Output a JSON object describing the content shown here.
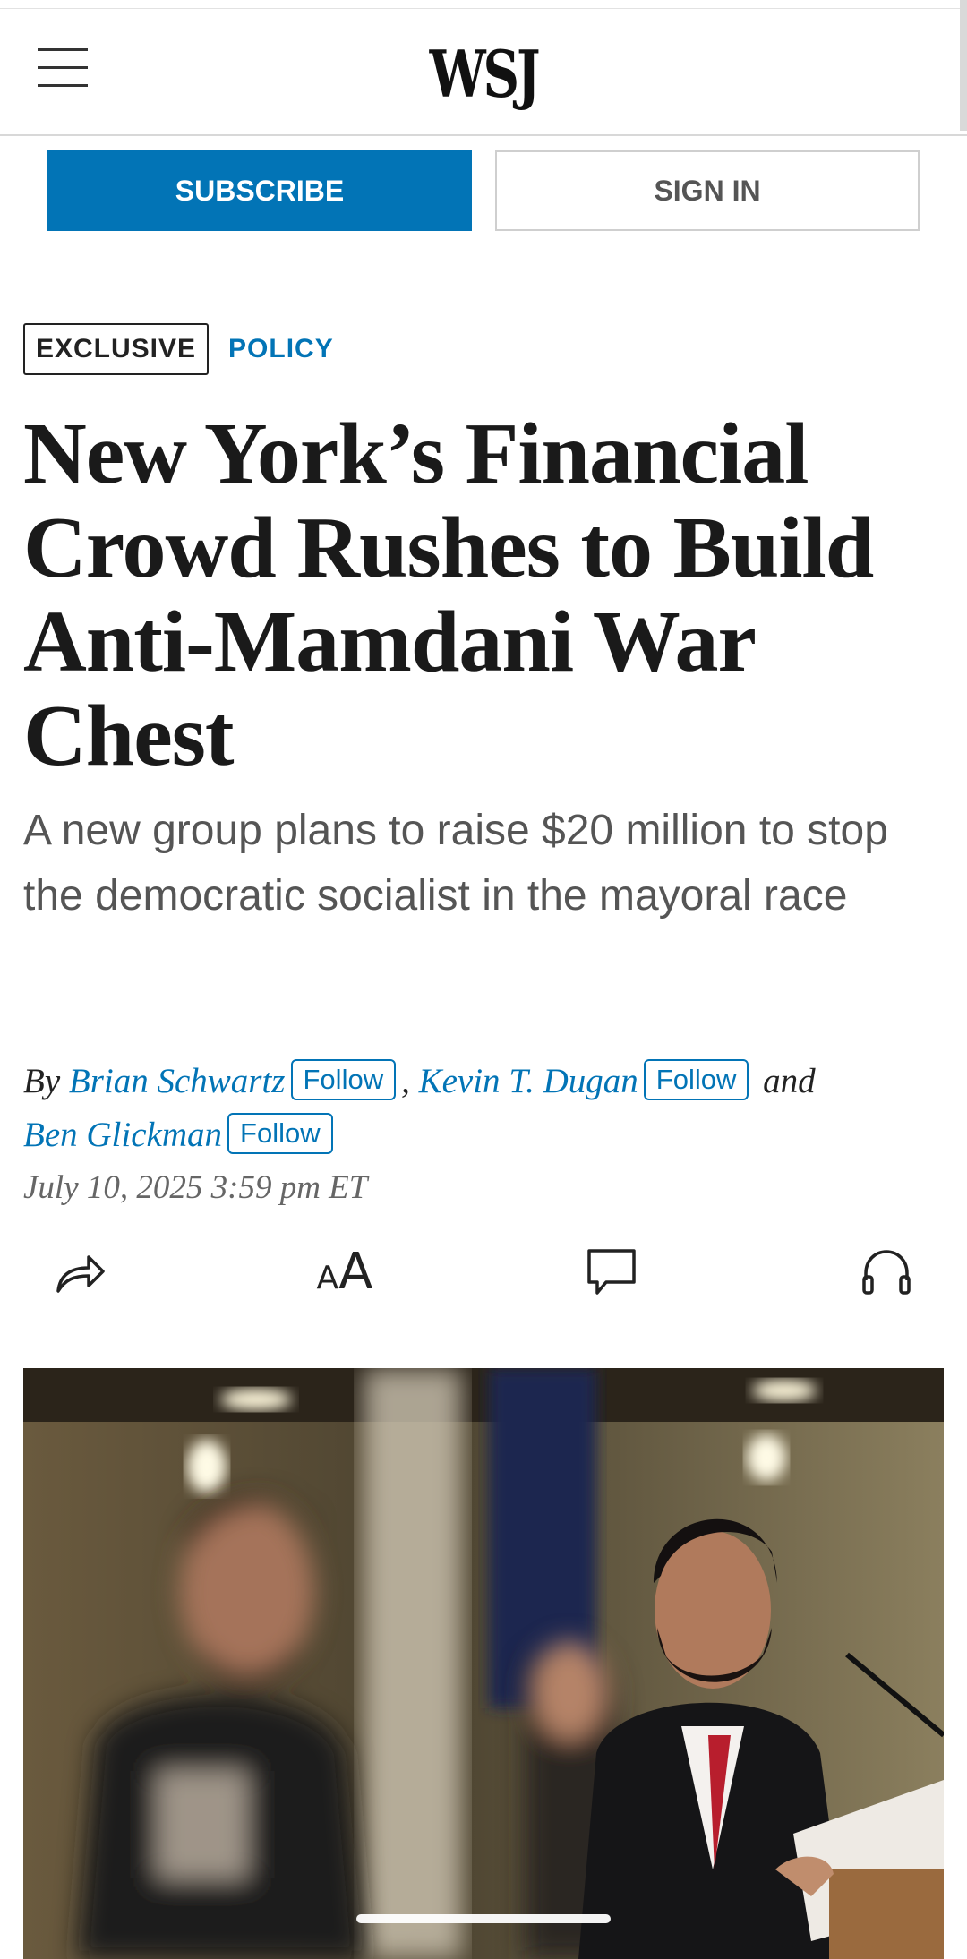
{
  "header": {
    "logo": "WSJ",
    "menu_icon": "hamburger-menu-icon"
  },
  "actions": {
    "subscribe_label": "SUBSCRIBE",
    "signin_label": "SIGN IN"
  },
  "article": {
    "tags": {
      "exclusive": "EXCLUSIVE",
      "section": "POLICY"
    },
    "headline": "New York’s Financial Crowd Rushes to Build Anti-Mamdani War Chest",
    "dek": "A new group plans to raise $20 million to stop the democratic socialist in the mayoral race",
    "byline": {
      "by": "By",
      "authors": [
        {
          "name": "Brian Schwartz",
          "follow": "Follow"
        },
        {
          "name": "Kevin T. Dugan",
          "follow": "Follow"
        },
        {
          "name": "Ben Glickman",
          "follow": "Follow"
        }
      ],
      "separator": ",",
      "and": "and"
    },
    "date": "July 10, 2025 3:59 pm ET"
  },
  "toolbar": {
    "icons": [
      "share-icon",
      "text-size-icon",
      "comment-icon",
      "headphones-icon"
    ],
    "text_size_glyph": "A"
  },
  "colors": {
    "brand_blue": "#0274b6",
    "headline": "#1a1a1a",
    "dek": "#555555"
  }
}
